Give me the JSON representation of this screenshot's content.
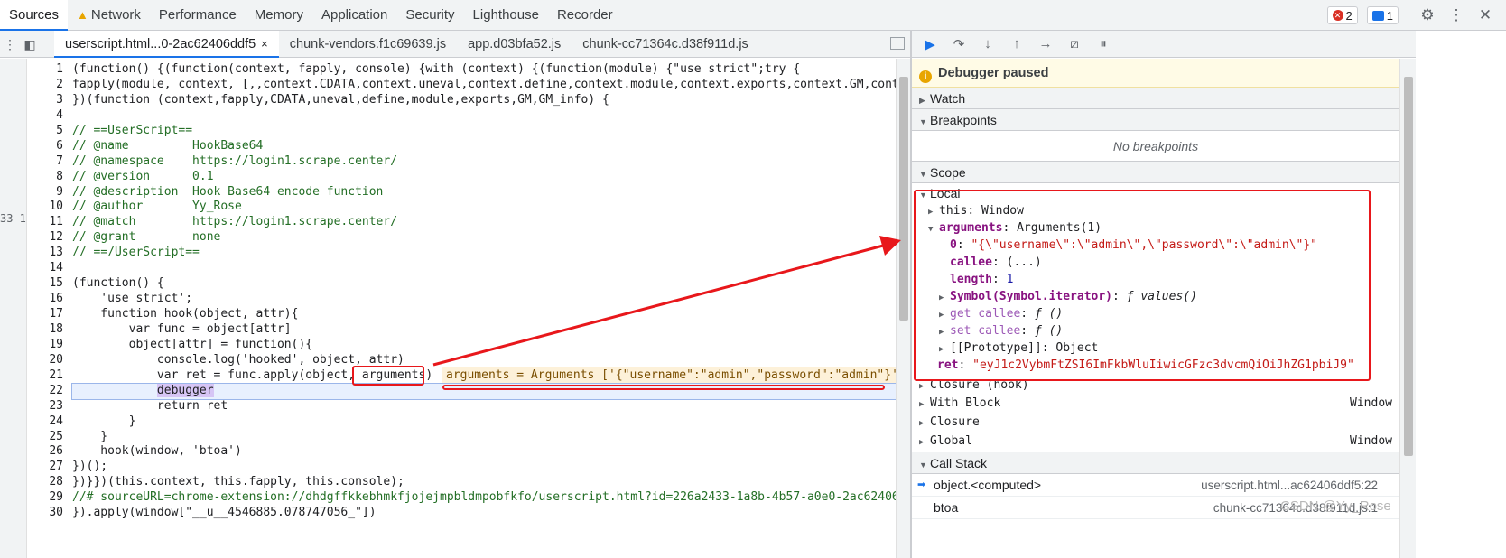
{
  "top_tabs": [
    {
      "label": "Sources",
      "active": true
    },
    {
      "label": "Network",
      "warning": true
    },
    {
      "label": "Performance"
    },
    {
      "label": "Memory"
    },
    {
      "label": "Application"
    },
    {
      "label": "Security"
    },
    {
      "label": "Lighthouse"
    },
    {
      "label": "Recorder"
    }
  ],
  "top_right": {
    "error_count": "2",
    "message_count": "1"
  },
  "file_tabs": [
    {
      "label": "userscript.html...0-2ac62406ddf5",
      "active": true,
      "close": "×"
    },
    {
      "label": "chunk-vendors.f1c69639.js"
    },
    {
      "label": "app.d03bfa52.js"
    },
    {
      "label": "chunk-cc71364c.d38f911d.js"
    }
  ],
  "editor": {
    "strip_text": "33-1",
    "line_numbers": [
      "1",
      "2",
      "3",
      "4",
      "5",
      "6",
      "7",
      "8",
      "9",
      "10",
      "11",
      "12",
      "13",
      "14",
      "15",
      "16",
      "17",
      "18",
      "19",
      "20",
      "21",
      "22",
      "23",
      "24",
      "25",
      "26",
      "27",
      "28",
      "29",
      "30"
    ],
    "lines": [
      "(function() {(function(context, fapply, console) {with (context) {(function(module) {\"use strict\";try {",
      "fapply(module, context, [,,context.CDATA,context.uneval,context.define,context.module,context.exports,context.GM,context.GM_info]);",
      "})(function (context,fapply,CDATA,uneval,define,module,exports,GM,GM_info) {",
      "",
      "// ==UserScript==",
      "// @name         HookBase64",
      "// @namespace    https://login1.scrape.center/",
      "// @version      0.1",
      "// @description  Hook Base64 encode function",
      "// @author       Yy_Rose",
      "// @match        https://login1.scrape.center/",
      "// @grant        none",
      "// ==/UserScript==",
      "",
      "(function() {",
      "    'use strict';",
      "    function hook(object, attr){",
      "        var func = object[attr]",
      "        object[attr] = function(){",
      "            console.log('hooked', object, attr)",
      "            var ret = func.apply(object, arguments)",
      "            debugger",
      "            return ret",
      "        }",
      "    }",
      "    hook(window, 'btoa')",
      "})();",
      "})}})(this.context, this.fapply, this.console);",
      "//# sourceURL=chrome-extension://dhdgffkkebhmkfjojejmpbldmpobfkfo/userscript.html?id=226a2433-1a8b-4b57-a0e0-2ac62406ddf5",
      "}).apply(window[\"__u__4546885.078747056_\"])"
    ],
    "inline_hint": "arguments = Arguments ['{\"username\":\"admin\",\"password\":\"admin\"}'"
  },
  "debugger": {
    "paused_text": "Debugger paused",
    "sections": {
      "watch": "Watch",
      "breakpoints": "Breakpoints",
      "scope": "Scope",
      "call_stack": "Call Stack"
    },
    "no_breakpoints": "No breakpoints",
    "scope": {
      "local": "Local",
      "this_key": "this",
      "this_val": "Window",
      "arguments_key": "arguments",
      "arguments_val": "Arguments(1)",
      "arg0_key": "0",
      "arg0_val": "\"{\\\"username\\\":\\\"admin\\\",\\\"password\\\":\\\"admin\\\"}\"",
      "callee_key": "callee",
      "callee_val": "(...)",
      "length_key": "length",
      "length_val": "1",
      "iter_key": "Symbol(Symbol.iterator)",
      "iter_val": "ƒ values()",
      "getcallee_key": "get callee",
      "getcallee_val": "ƒ ()",
      "setcallee_key": "set callee",
      "setcallee_val": "ƒ ()",
      "proto_key": "[[Prototype]]",
      "proto_val": "Object",
      "ret_key": "ret",
      "ret_val": "\"eyJ1c2VybmFtZSI6ImFkbWluIiwicGFzc3dvcmQiOiJhZG1pbiJ9\"",
      "closure_hook": "Closure (hook)",
      "with_block": "With Block",
      "with_block_val": "Window",
      "closure": "Closure",
      "global": "Global",
      "global_val": "Window"
    },
    "call_stack": [
      {
        "fn": "object.<computed>",
        "loc": "userscript.html...ac62406ddf5:22",
        "current": true
      },
      {
        "fn": "btoa",
        "loc": "chunk-cc71364c.d38f911d.js:1"
      }
    ]
  },
  "watermark": "CSDN @Yy_Rose",
  "colors": {
    "accent": "#1a73e8",
    "annotation_red": "#e8171b",
    "paused_bg": "#fffbe6"
  }
}
